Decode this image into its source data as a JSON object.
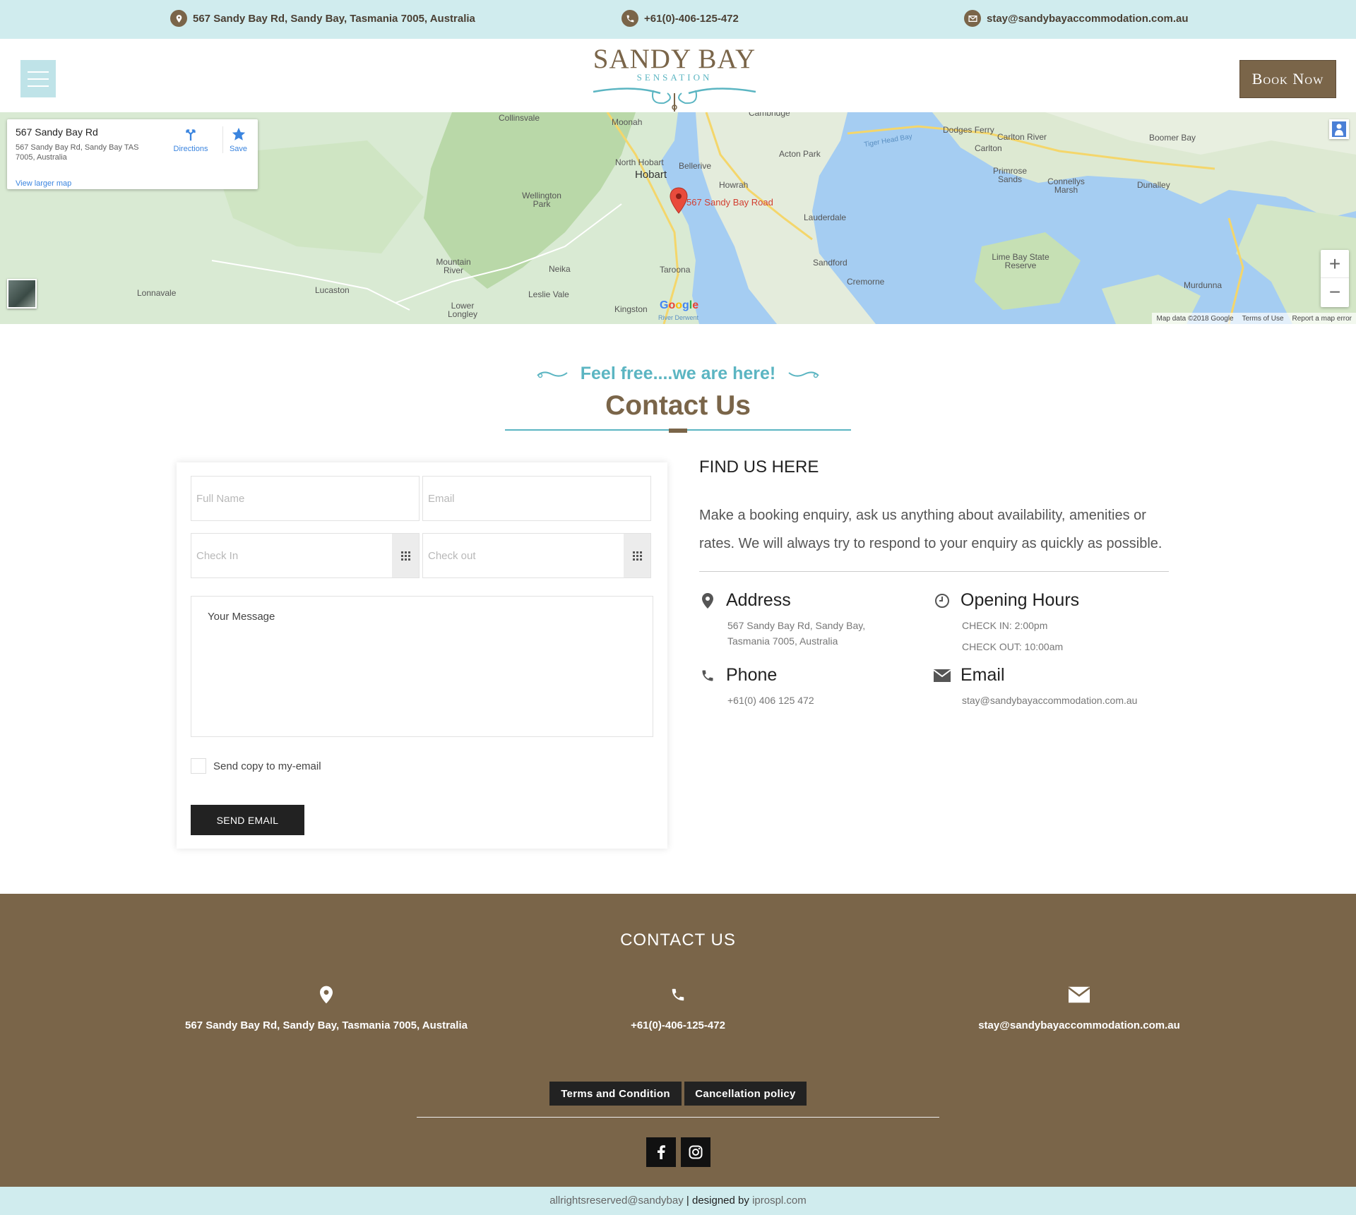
{
  "topbar": {
    "address": "567 Sandy Bay Rd, Sandy Bay, Tasmania 7005, Australia",
    "phone": "+61(0)-406-125-472",
    "email": "stay@sandybayaccommodation.com.au"
  },
  "header": {
    "logo_line1": "SANDY BAY",
    "logo_line2": "SENSATION",
    "book_label": "Book Now"
  },
  "map": {
    "card_title": "567 Sandy Bay Rd",
    "card_address": "567 Sandy Bay Rd, Sandy Bay TAS 7005, Australia",
    "directions_label": "Directions",
    "save_label": "Save",
    "larger_label": "View larger map",
    "pin_label": "567 Sandy Bay Road",
    "google_label": "Google",
    "footer_data": "Map data ©2018 Google",
    "footer_terms": "Terms of Use",
    "footer_report": "Report a map error",
    "zoom_in": "+",
    "zoom_out": "−",
    "places": [
      "Collinsvale",
      "Moonah",
      "Cambridge",
      "North Hobart",
      "Bellerive",
      "Hobart",
      "Howrah",
      "Acton Park",
      "Lauderdale",
      "Tiger Head Bay",
      "Dodges Ferry",
      "Carlton River",
      "Carlton",
      "Primrose Sands",
      "Connellys Marsh",
      "Dunalley",
      "Boomer Bay",
      "Wellington Park",
      "Mountain River",
      "Neika",
      "Taroona",
      "Sandford",
      "Cremorne",
      "Lime Bay State Reserve",
      "Murdunna",
      "Lonnavale",
      "Lucaston",
      "Leslie Vale",
      "Lower Longley",
      "Kingston",
      "River Derwent"
    ]
  },
  "contact": {
    "tagline": "Feel free....we are here!",
    "title": "Contact Us"
  },
  "form": {
    "full_name_placeholder": "Full Name",
    "email_placeholder": "Email",
    "checkin_placeholder": "Check In",
    "checkout_placeholder": "Check out",
    "message_placeholder": "Your Message",
    "copy_label": "Send copy to my-email",
    "send_label": "SEND EMAIL"
  },
  "find": {
    "title": "FIND US HERE",
    "text": "Make a booking enquiry, ask us anything about availability, amenities or rates. We will always try to respond to your enquiry as quickly as possible.",
    "address_head": "Address",
    "address_line1": "567 Sandy Bay Rd, Sandy Bay,",
    "address_line2": "Tasmania 7005, Australia",
    "hours_head": "Opening Hours",
    "checkin": "CHECK IN: 2:00pm",
    "checkout": "CHECK OUT: 10:00am",
    "phone_head": "Phone",
    "phone": "+61(0) 406 125 472",
    "email_head": "Email",
    "email": "stay@sandybayaccommodation.com.au"
  },
  "footer": {
    "title": "CONTACT US",
    "address": "567 Sandy Bay Rd, Sandy Bay, Tasmania 7005, Australia",
    "phone": "+61(0)-406-125-472",
    "email": "stay@sandybayaccommodation.com.au",
    "terms_label": "Terms and Condition",
    "cancel_label": "Cancellation policy",
    "copyright": "allrightsreserved@sandybay",
    "separator": "|",
    "designed_by": "designed by",
    "designer": "iprospl.com"
  },
  "colors": {
    "brand_brown": "#7a6549",
    "accent_teal": "#5bb5c2",
    "topbar_bg": "#d0ecee"
  }
}
